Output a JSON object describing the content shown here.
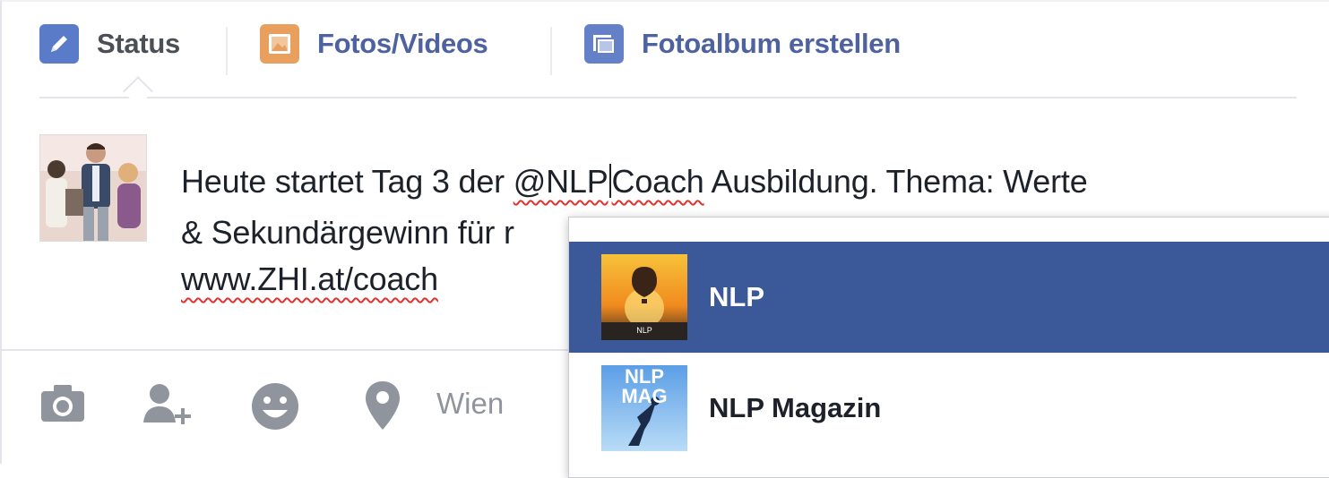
{
  "tabs": [
    {
      "label": "Status",
      "icon": "pencil-icon"
    },
    {
      "label": "Fotos/Videos",
      "icon": "photo-icon"
    },
    {
      "label": "Fotoalbum erstellen",
      "icon": "album-icon"
    }
  ],
  "post": {
    "line1_before": "Heute startet Tag 3 der ",
    "mention": "@NLP",
    "line1_after_word": "Coach",
    "line1_rest": " Ausbildung. Thema: Werte",
    "line2": "& Sekundärgewinn für r",
    "line3": "www.ZHI.at/coach"
  },
  "bottom_bar": {
    "icons": [
      "camera-icon",
      "tag-friend-icon",
      "smiley-icon",
      "location-pin-icon"
    ],
    "location": "Wien"
  },
  "suggestions": [
    {
      "name": "NLP",
      "thumb_text": "NLP",
      "selected": true
    },
    {
      "name": "NLP Magazin",
      "thumb_text_1": "NLP",
      "thumb_text_2": "MAG",
      "selected": false
    }
  ],
  "colors": {
    "accent": "#3b5998",
    "link": "#4e62a0",
    "spellcheck": "#e0332e"
  }
}
